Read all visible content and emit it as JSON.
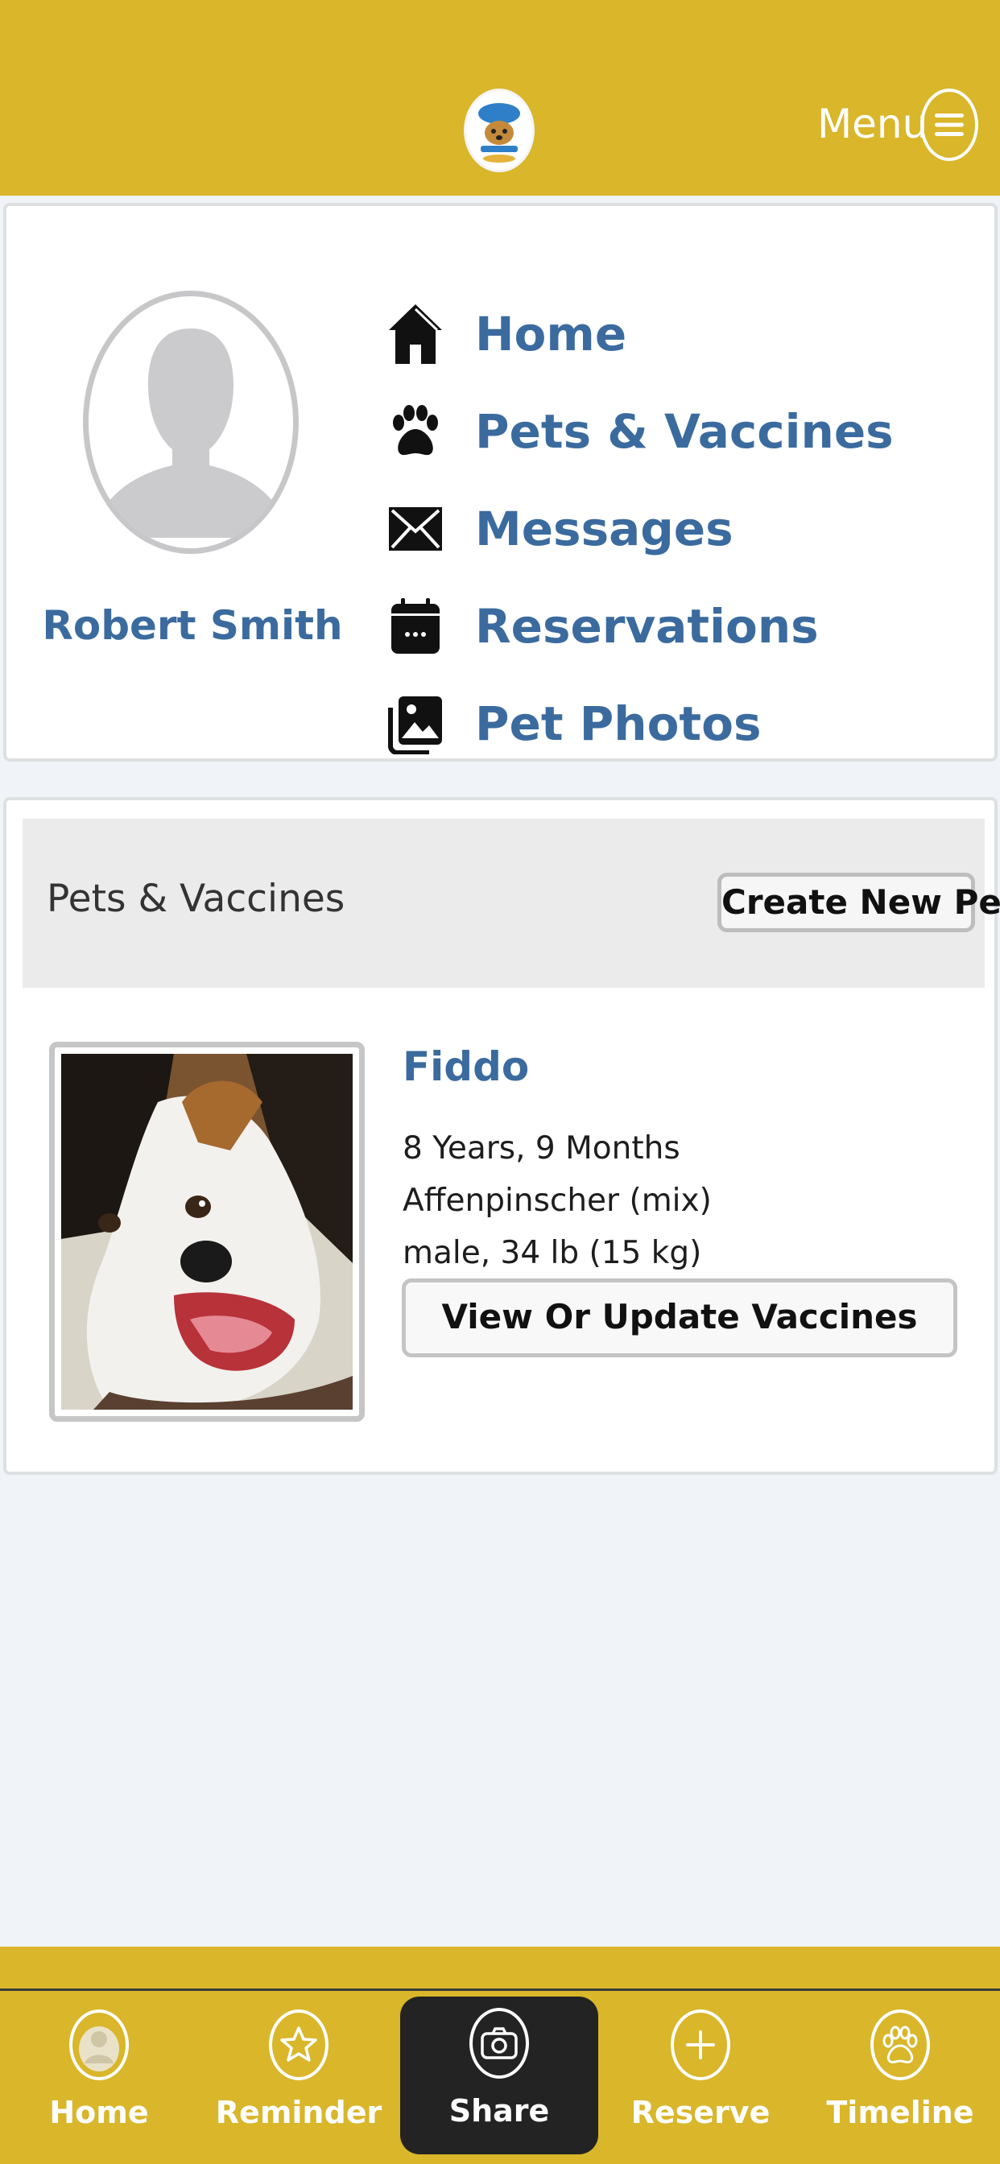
{
  "header": {
    "logo_icon": "dog-logo-icon",
    "menu_label": "Menu",
    "menu_icon": "hamburger-icon",
    "bg_color": "#d9b62a"
  },
  "profile": {
    "user_name": "Robert Smith",
    "avatar_icon": "person-silhouette-icon",
    "nav": [
      {
        "label": "Home",
        "icon": "house-icon"
      },
      {
        "label": "Pets & Vaccines",
        "icon": "paw-icon"
      },
      {
        "label": "Messages",
        "icon": "envelope-icon"
      },
      {
        "label": "Reservations",
        "icon": "calendar-icon"
      },
      {
        "label": "Pet Photos",
        "icon": "photos-icon"
      }
    ]
  },
  "pets_section": {
    "title": "Pets & Vaccines",
    "create_button": "Create New Pet",
    "pets": [
      {
        "name": "Fiddo",
        "age": "8 Years, 9 Months",
        "breed": "Affenpinscher (mix)",
        "sex_weight": "male, 34 lb (15 kg)",
        "action": "View Or Update Vaccines"
      }
    ]
  },
  "tabbar": {
    "tabs": [
      {
        "label": "Home",
        "icon": "person-icon"
      },
      {
        "label": "Reminder",
        "icon": "star-icon"
      },
      {
        "label": "Share",
        "icon": "camera-icon",
        "active": true
      },
      {
        "label": "Reserve",
        "icon": "plus-icon"
      },
      {
        "label": "Timeline",
        "icon": "paw-icon"
      }
    ]
  }
}
